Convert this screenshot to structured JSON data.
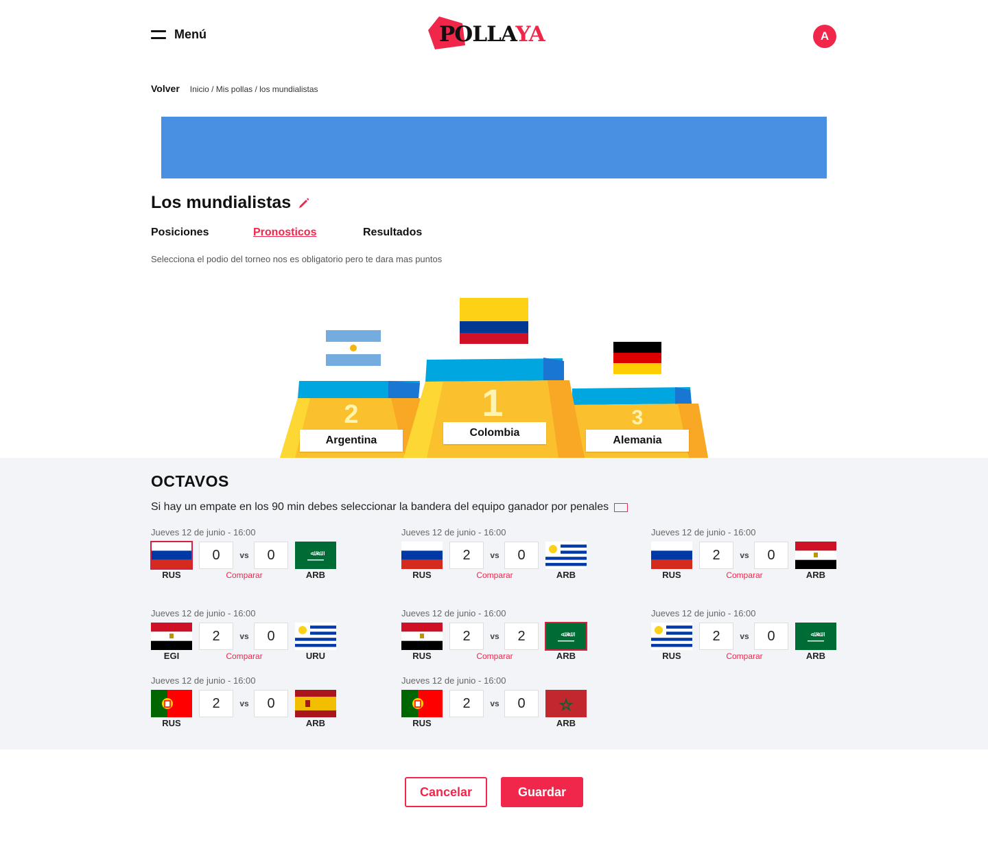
{
  "header": {
    "menu_label": "Menú",
    "logo": {
      "text_black": "POLLA",
      "text_red": "YA"
    },
    "avatar_initial": "A"
  },
  "breadcrumb": {
    "back_label": "Volver",
    "path": "Inicio / Mis pollas / los mundialistas"
  },
  "banner_color": "#4a90e2",
  "page": {
    "title": "Los mundialistas",
    "tabs": [
      {
        "label": "Posiciones",
        "active": false
      },
      {
        "label": "Pronosticos",
        "active": true
      },
      {
        "label": "Resultados",
        "active": false
      }
    ],
    "hint": "Selecciona el podio del torneo nos es obligatorio pero te dara mas puntos"
  },
  "podium": {
    "first": {
      "place": "1",
      "team": "Colombia",
      "flag": "colombia-flag"
    },
    "second": {
      "place": "2",
      "team": "Argentina",
      "flag": "argentina-flag"
    },
    "third": {
      "place": "3",
      "team": "Alemania",
      "flag": "germany-flag"
    }
  },
  "octavos": {
    "title": "OCTAVOS",
    "note": "Si hay un empate en los 90 min debes seleccionar la bandera del equipo ganador por penales",
    "compare_label": "Comparar",
    "vs_label": "vs",
    "matches": [
      {
        "date": "Jueves 12 de junio - 16:00",
        "home": {
          "code": "RUS",
          "flag": "russia"
        },
        "away": {
          "code": "ARB",
          "flag": "saudi"
        },
        "home_score": "0",
        "away_score": "0",
        "selected": "home",
        "compare": true
      },
      {
        "date": "Jueves 12 de junio - 16:00",
        "home": {
          "code": "RUS",
          "flag": "russia"
        },
        "away": {
          "code": "ARB",
          "flag": "uruguay"
        },
        "home_score": "2",
        "away_score": "0",
        "selected": "",
        "compare": true
      },
      {
        "date": "Jueves 12 de junio - 16:00",
        "home": {
          "code": "RUS",
          "flag": "russia"
        },
        "away": {
          "code": "ARB",
          "flag": "egypt"
        },
        "home_score": "2",
        "away_score": "0",
        "selected": "",
        "compare": true
      },
      {
        "date": "Jueves 12 de junio - 16:00",
        "home": {
          "code": "EGI",
          "flag": "egypt"
        },
        "away": {
          "code": "URU",
          "flag": "uruguay"
        },
        "home_score": "2",
        "away_score": "0",
        "selected": "",
        "compare": true
      },
      {
        "date": "Jueves 12 de junio - 16:00",
        "home": {
          "code": "RUS",
          "flag": "egypt"
        },
        "away": {
          "code": "ARB",
          "flag": "saudi"
        },
        "home_score": "2",
        "away_score": "2",
        "selected": "away",
        "compare": true
      },
      {
        "date": "Jueves 12 de junio - 16:00",
        "home": {
          "code": "RUS",
          "flag": "uruguay"
        },
        "away": {
          "code": "ARB",
          "flag": "saudi"
        },
        "home_score": "2",
        "away_score": "0",
        "selected": "",
        "compare": true
      },
      {
        "date": "Jueves 12 de junio - 16:00",
        "home": {
          "code": "RUS",
          "flag": "portugal"
        },
        "away": {
          "code": "ARB",
          "flag": "spain"
        },
        "home_score": "2",
        "away_score": "0",
        "selected": "",
        "compare": false
      },
      {
        "date": "Jueves 12 de junio - 16:00",
        "home": {
          "code": "RUS",
          "flag": "portugal"
        },
        "away": {
          "code": "ARB",
          "flag": "morocco"
        },
        "home_score": "2",
        "away_score": "0",
        "selected": "",
        "compare": false
      }
    ]
  },
  "actions": {
    "cancel_label": "Cancelar",
    "save_label": "Guardar"
  },
  "colors": {
    "accent": "#f0264b",
    "podium_yellow": "#fbc02d",
    "podium_blue": "#00a6e0"
  }
}
